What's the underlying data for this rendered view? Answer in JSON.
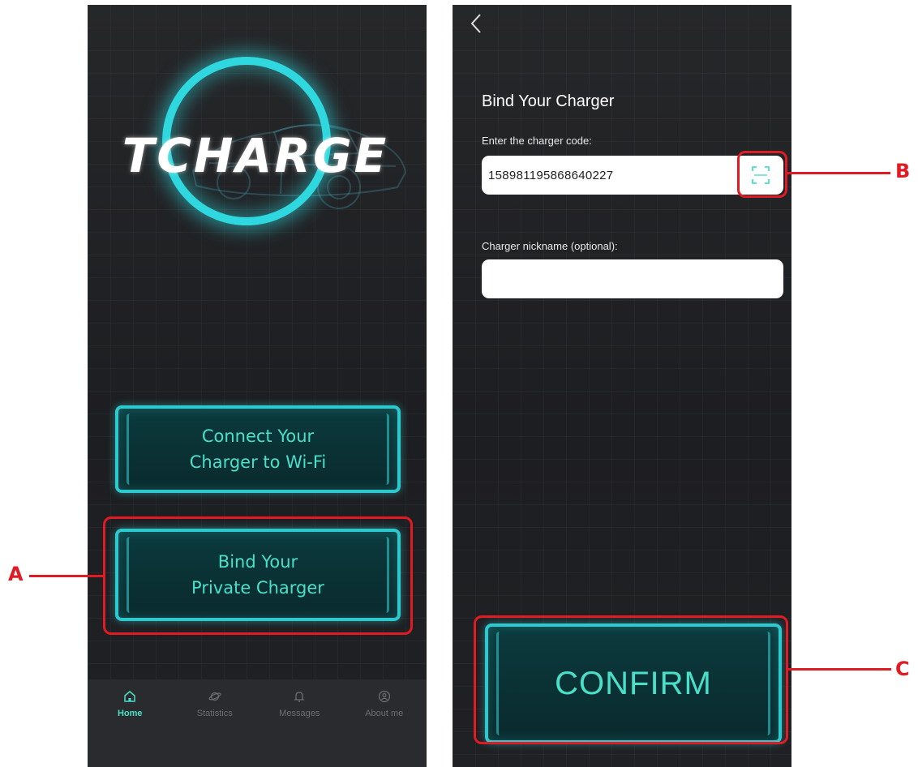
{
  "left_screen": {
    "logo_text": "TCHARGE",
    "buttons": {
      "connect_wifi": "Connect Your\nCharger to Wi-Fi",
      "bind_charger": "Bind Your\nPrivate Charger"
    },
    "bottom_nav": [
      {
        "label": "Home",
        "icon": "home-icon",
        "active": true
      },
      {
        "label": "Statistics",
        "icon": "planet-icon",
        "active": false
      },
      {
        "label": "Messages",
        "icon": "bell-icon",
        "active": false
      },
      {
        "label": "About me",
        "icon": "user-circle-icon",
        "active": false
      }
    ]
  },
  "right_screen": {
    "title": "Bind Your Charger",
    "code_label": "Enter the charger code:",
    "code_value": "158981195868640227",
    "nickname_label": "Charger nickname (optional):",
    "nickname_value": "",
    "confirm_label": "CONFIRM"
  },
  "annotations": {
    "a": "A",
    "b": "B",
    "c": "C"
  },
  "colors": {
    "accent": "#2cc9cf",
    "accent_text": "#49e0c9",
    "annotation": "#e01b24",
    "background": "#1e1f22"
  }
}
